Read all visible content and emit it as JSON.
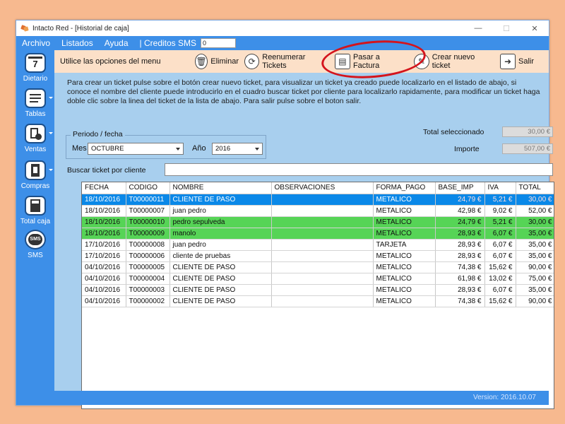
{
  "window": {
    "title": "Intacto Red - [Historial de caja]",
    "minimize": "—",
    "maximize": "☐",
    "close": "✕"
  },
  "menu": {
    "items": [
      "Archivo",
      "Listados",
      "Ayuda",
      "| Creditos SMS"
    ],
    "sms_credits_value": "0"
  },
  "sidebar": {
    "items": [
      {
        "label": "Dietario",
        "icon": "calendar-icon",
        "calendar_day": "7"
      },
      {
        "label": "Tablas",
        "icon": "table-icon"
      },
      {
        "label": "Ventas",
        "icon": "sales-icon"
      },
      {
        "label": "Compras",
        "icon": "clipboard-icon"
      },
      {
        "label": "Total caja",
        "icon": "calculator-icon"
      },
      {
        "label": "SMS",
        "icon": "sms-icon",
        "badge": "SMS"
      }
    ]
  },
  "toolbar": {
    "lead_text": "Utilice las opciones del menu",
    "buttons": [
      {
        "label": "Eliminar",
        "icon": "trash-icon",
        "glyph": "🗑"
      },
      {
        "label": "Reenumerar Tickets",
        "icon": "refresh-icon",
        "glyph": "⟳"
      },
      {
        "label": "Pasar a Factura",
        "icon": "invoice-icon",
        "glyph": "▤"
      },
      {
        "label": "Crear nuevo ticket",
        "icon": "new-ticket-icon",
        "glyph": "✎"
      },
      {
        "label": "Salir",
        "icon": "exit-icon",
        "glyph": "➜"
      }
    ]
  },
  "instructions": "Para crear un ticket pulse sobre el botón crear nuevo ticket, para visualizar un ticket ya creado puede localizarlo en el listado de abajo, si conoce el nombre del cliente puede introducirlo en el cuadro buscar ticket por cliente para localizarlo rapidamente, para modificar un ticket haga doble clic sobre la linea del ticket de la lista de abajo. Para salir pulse sobre el boton salir.",
  "filters": {
    "period_legend": "Periodo / fecha",
    "month_label": "Mes",
    "month_value": "OCTUBRE",
    "year_label": "Año",
    "year_value": "2016"
  },
  "totals": {
    "selected_label": "Total seleccionado",
    "selected_value": "30,00 €",
    "amount_label": "Importe",
    "amount_value": "507,00 €"
  },
  "search": {
    "label": "Buscar ticket por cliente",
    "value": ""
  },
  "table": {
    "columns": [
      "FECHA",
      "CODIGO",
      "NOMBRE",
      "OBSERVACIONES",
      "FORMA_PAGO",
      "BASE_IMP",
      "IVA",
      "TOTAL"
    ],
    "rows": [
      {
        "state": "selected",
        "cells": [
          "18/10/2016",
          "T00000011",
          "CLIENTE DE PASO",
          "",
          "METALICO",
          "24,79 €",
          "5,21 €",
          "30,00 €"
        ]
      },
      {
        "state": "normal",
        "cells": [
          "18/10/2016",
          "T00000007",
          "juan pedro",
          "",
          "METALICO",
          "42,98 €",
          "9,02 €",
          "52,00 €"
        ]
      },
      {
        "state": "green",
        "cells": [
          "18/10/2016",
          "T00000010",
          "pedro sepulveda",
          "",
          "METALICO",
          "24,79 €",
          "5,21 €",
          "30,00 €"
        ]
      },
      {
        "state": "green",
        "cells": [
          "18/10/2016",
          "T00000009",
          "manolo",
          "",
          "METALICO",
          "28,93 €",
          "6,07 €",
          "35,00 €"
        ]
      },
      {
        "state": "normal",
        "cells": [
          "17/10/2016",
          "T00000008",
          "juan pedro",
          "",
          "TARJETA",
          "28,93 €",
          "6,07 €",
          "35,00 €"
        ]
      },
      {
        "state": "normal",
        "cells": [
          "17/10/2016",
          "T00000006",
          "cliente de pruebas",
          "",
          "METALICO",
          "28,93 €",
          "6,07 €",
          "35,00 €"
        ]
      },
      {
        "state": "normal",
        "cells": [
          "04/10/2016",
          "T00000005",
          "CLIENTE DE PASO",
          "",
          "METALICO",
          "74,38 €",
          "15,62 €",
          "90,00 €"
        ]
      },
      {
        "state": "normal",
        "cells": [
          "04/10/2016",
          "T00000004",
          "CLIENTE DE PASO",
          "",
          "METALICO",
          "61,98 €",
          "13,02 €",
          "75,00 €"
        ]
      },
      {
        "state": "normal",
        "cells": [
          "04/10/2016",
          "T00000003",
          "CLIENTE DE PASO",
          "",
          "METALICO",
          "28,93 €",
          "6,07 €",
          "35,00 €"
        ]
      },
      {
        "state": "normal",
        "cells": [
          "04/10/2016",
          "T00000002",
          "CLIENTE DE PASO",
          "",
          "METALICO",
          "74,38 €",
          "15,62 €",
          "90,00 €"
        ]
      }
    ]
  },
  "status": {
    "version": "Version: 2016.10.07"
  },
  "colors": {
    "menu_blue": "#3d8fe8",
    "toolbar_peach": "#fce0c8",
    "content_blue": "#a8cfee",
    "selected_row": "#0a88e8",
    "green_row": "#56d456",
    "highlight_circle": "#d4141c"
  }
}
